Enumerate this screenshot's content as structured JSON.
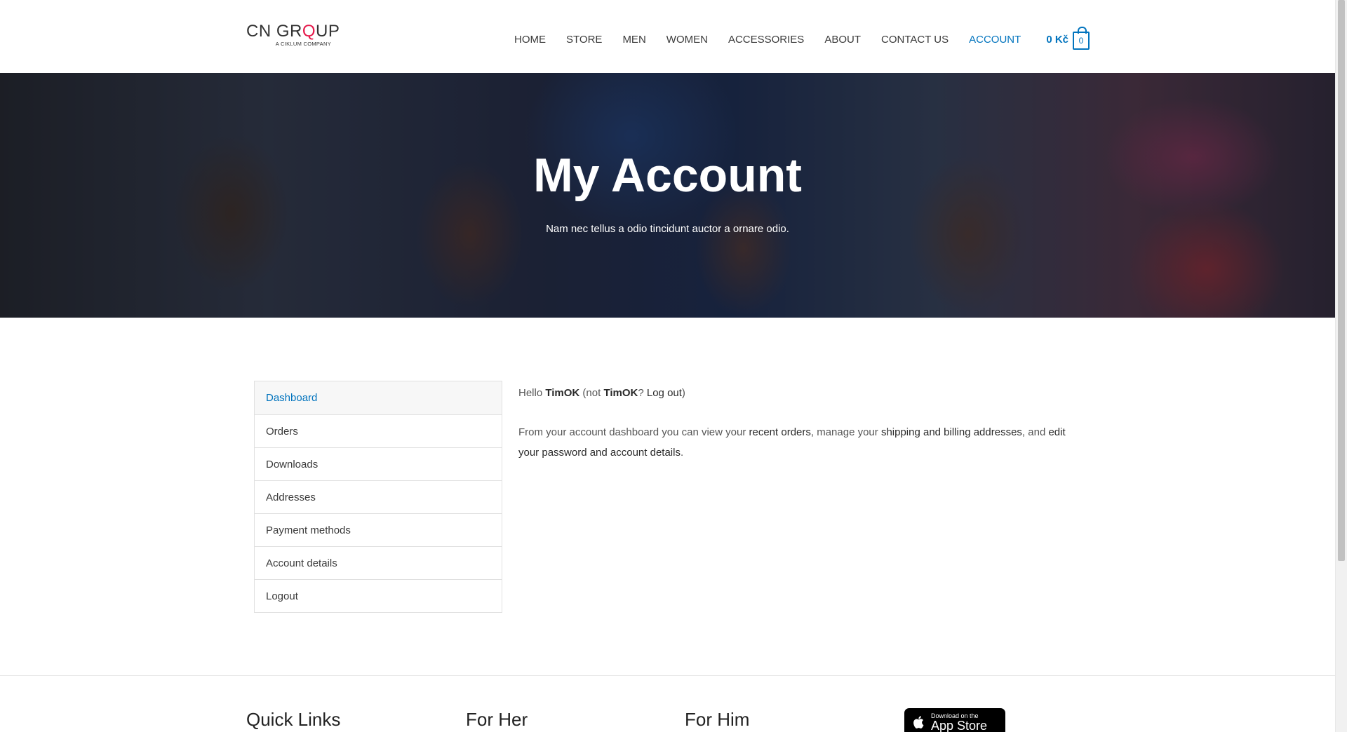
{
  "header": {
    "logo_main_pre": "CN GR",
    "logo_main_q": "Q",
    "logo_main_post": "UP",
    "logo_sub": "A CIKLUM COMPANY",
    "nav": [
      "HOME",
      "STORE",
      "MEN",
      "WOMEN",
      "ACCESSORIES",
      "ABOUT",
      "CONTACT US",
      "ACCOUNT"
    ],
    "active_nav": "ACCOUNT",
    "cart_total": "0 Kč",
    "cart_count": "0"
  },
  "hero": {
    "title": "My Account",
    "subtitle": "Nam nec tellus a odio tincidunt auctor a ornare odio."
  },
  "account_nav": {
    "items": [
      "Dashboard",
      "Orders",
      "Downloads",
      "Addresses",
      "Payment methods",
      "Account details",
      "Logout"
    ],
    "active": "Dashboard"
  },
  "dashboard": {
    "hello": "Hello ",
    "username": "TimOK",
    "not_open": " (not ",
    "not_user": "TimOK",
    "question": "? ",
    "logout_link": "Log out",
    "close_paren": ")",
    "text_1": "From your account dashboard you can view your ",
    "link_orders": "recent orders",
    "text_2": ", manage your ",
    "link_addresses": "shipping and billing addresses",
    "text_3": ", and ",
    "link_account": "edit your password and account details",
    "text_4": "."
  },
  "footer": {
    "col1": "Quick Links",
    "col2": "For Her",
    "col3": "For Him",
    "appstore_small": "Download on the",
    "appstore_big": "App Store"
  },
  "colors": {
    "accent": "#0274be",
    "logo_accent": "#e6194b"
  }
}
